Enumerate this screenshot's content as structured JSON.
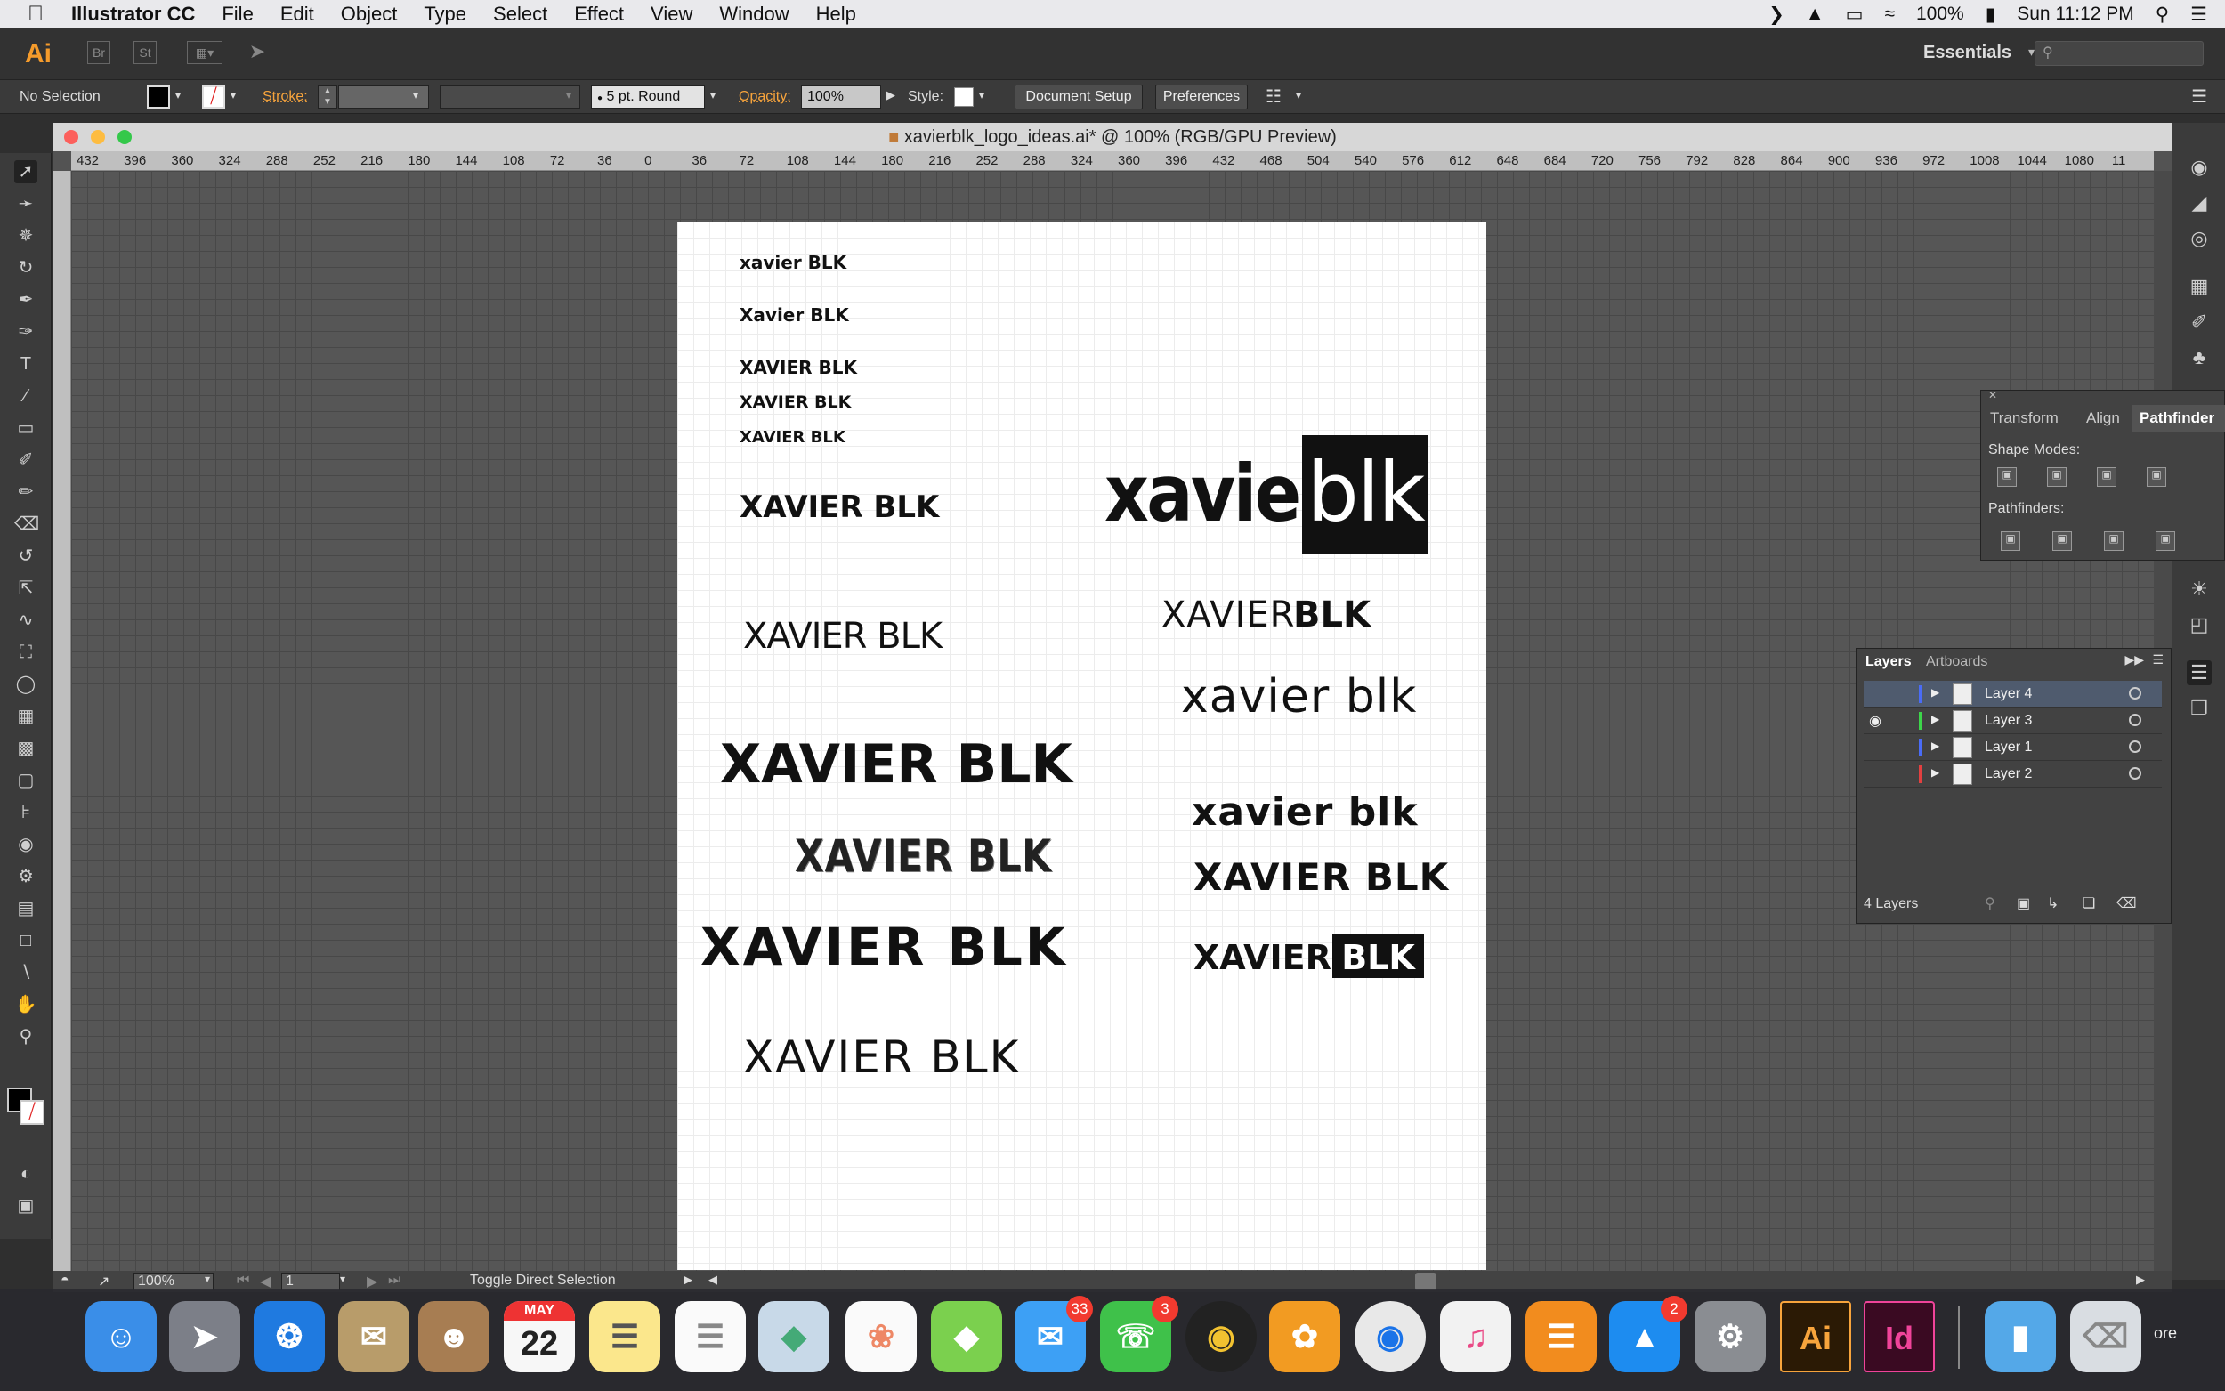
{
  "menubar": {
    "app_name": "Illustrator CC",
    "items": [
      "File",
      "Edit",
      "Object",
      "Type",
      "Select",
      "Effect",
      "View",
      "Window",
      "Help"
    ],
    "battery": "100%",
    "clock": "Sun 11:12 PM"
  },
  "appbar": {
    "logo": "Ai",
    "bridge": "Br",
    "stock": "St",
    "workspace": "Essentials"
  },
  "control": {
    "selection": "No Selection",
    "stroke_label": "Stroke:",
    "brush": "5 pt. Round",
    "opacity_label": "Opacity:",
    "opacity_value": "100%",
    "style_label": "Style:",
    "document_setup": "Document Setup",
    "preferences": "Preferences"
  },
  "document": {
    "title": "xavierblk_logo_ideas.ai* @ 100% (RGB/GPU Preview)",
    "ruler_labels": [
      "432",
      "396",
      "360",
      "324",
      "288",
      "252",
      "216",
      "180",
      "144",
      "108",
      "72",
      "36",
      "0",
      "36",
      "72",
      "108",
      "144",
      "180",
      "216",
      "252",
      "288",
      "324",
      "360",
      "396",
      "432",
      "468",
      "504",
      "540",
      "576",
      "612",
      "648",
      "684",
      "720",
      "756",
      "792",
      "828",
      "864",
      "900",
      "936",
      "972",
      "1008",
      "1044",
      "1080",
      "11"
    ]
  },
  "logos": {
    "l1": "xavier BLK",
    "l2": "Xavier BLK",
    "l3": "XAVIER BLK",
    "l4": "XAVIER BLK",
    "l5": "XAVIER BLK",
    "l6": "XAVIER BLK",
    "l7": "XAVIER BLK",
    "l8": "XAVIER BLK",
    "l9": "XAVIER BLK",
    "l10": "XAVIER BLK",
    "l11": "XAVIER BLK",
    "r1_word": "xavier",
    "r1_box": "blk",
    "r2_word": "XAVIER",
    "r2_bold": "BLK",
    "r3": "xavier blk",
    "r4": "xavier blk",
    "r5": "XAVIER BLK",
    "r6_word": "XAVIER",
    "r6_box": "BLK"
  },
  "status": {
    "zoom": "100%",
    "artboard": "1",
    "message": "Toggle Direct Selection"
  },
  "pathfinder": {
    "tabs": [
      "Transform",
      "Align",
      "Pathfinder"
    ],
    "shape_modes": "Shape Modes:",
    "pathfinders": "Pathfinders:"
  },
  "layers": {
    "tabs": [
      "Layers",
      "Artboards"
    ],
    "rows": [
      {
        "name": "Layer 4",
        "color": "#4a6cf7"
      },
      {
        "name": "Layer 3",
        "color": "#3dd64a"
      },
      {
        "name": "Layer 1",
        "color": "#4a6cf7"
      },
      {
        "name": "Layer 2",
        "color": "#e34040"
      }
    ],
    "count": "4 Layers"
  },
  "dock": {
    "calendar_month": "MAY",
    "calendar_day": "22",
    "messages_badge": "33",
    "facetime_badge": "3",
    "appstore_badge": "2",
    "ai_label": "Ai",
    "id_label": "Id",
    "more": "ore"
  }
}
